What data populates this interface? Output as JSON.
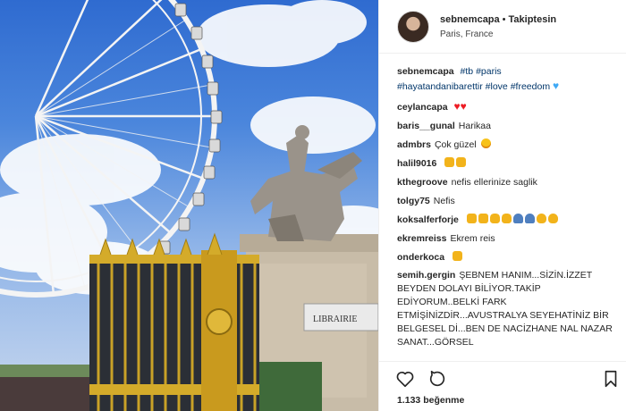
{
  "header": {
    "username": "sebnemcapa",
    "separator": "•",
    "follow_status": "Takiptesin",
    "location": "Paris, France"
  },
  "caption": {
    "username": "sebnemcapa",
    "hashtags": [
      "#tb",
      "#paris",
      "#hayatandanibarettir",
      "#love",
      "#freedom"
    ]
  },
  "comments": [
    {
      "user": "ceylancapa",
      "text": "",
      "emojis": [
        "heart-icon",
        "heart-icon"
      ]
    },
    {
      "user": "baris__gunal",
      "text": "Harikaa",
      "emojis": []
    },
    {
      "user": "admbrs",
      "text": "Çok güzel",
      "emojis": [
        "heart-eyes-icon"
      ]
    },
    {
      "user": "halil9016",
      "text": "",
      "emojis": [
        "thumbs-up-icon",
        "thumbs-up-icon"
      ]
    },
    {
      "user": "kthegroove",
      "text": "nefis ellerinize saglik",
      "emojis": []
    },
    {
      "user": "tolgy75",
      "text": "Nefis",
      "emojis": []
    },
    {
      "user": "koksalferforje",
      "text": "",
      "emojis": [
        "thumbs-up-icon",
        "thumbs-up-icon",
        "clap-icon",
        "clap-icon",
        "pray-icon",
        "pray-icon",
        "ok-hand-icon",
        "ok-hand-icon"
      ]
    },
    {
      "user": "ekremreiss",
      "text": "Ekrem reis",
      "emojis": []
    },
    {
      "user": "onderkoca",
      "text": "",
      "emojis": [
        "thumbs-up-icon"
      ]
    },
    {
      "user": "semih.gergin",
      "text": "ŞEBNEM HANIM...SİZİN.İZZET BEYDEN DOLAYI BİLİYOR.TAKİP EDİYORUM..BELKİ FARK ETMİŞİNİZDİR...AVUSTRALYA SEYEHATİNİZ BİR BELGESEL Dİ...BEN DE NACİZHANE NAL NAZAR SANAT...GÖRSEL",
      "emojis": []
    }
  ],
  "actions": {
    "like_icon": "heart-outline-icon",
    "comment_icon": "comment-bubble-icon",
    "save_icon": "bookmark-icon",
    "likes_text": "1.133 beğenme"
  },
  "photo": {
    "shop_sign": "LIBRAIRIE"
  },
  "colors": {
    "hashtag": "#003569",
    "border": "#efefef",
    "text": "#262626"
  }
}
